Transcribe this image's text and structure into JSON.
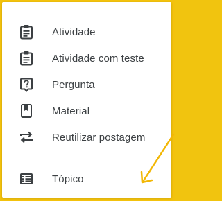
{
  "menu": {
    "items": [
      {
        "label": "Atividade",
        "icon": "assignment-icon"
      },
      {
        "label": "Atividade com teste",
        "icon": "assignment-quiz-icon"
      },
      {
        "label": "Pergunta",
        "icon": "question-icon"
      },
      {
        "label": "Material",
        "icon": "material-book-icon"
      },
      {
        "label": "Reutilizar postagem",
        "icon": "repost-icon"
      }
    ],
    "topic": {
      "label": "Tópico",
      "icon": "topic-list-icon"
    }
  },
  "colors": {
    "frame": "#f3c20d",
    "icon": "#3c4043",
    "divider": "#dadce0",
    "arrow": "#f2b705"
  }
}
